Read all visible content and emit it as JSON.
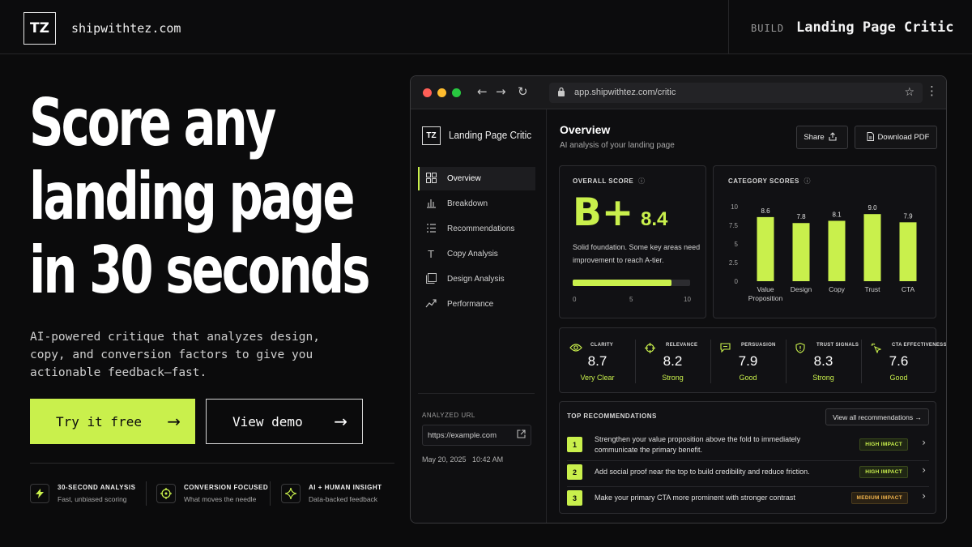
{
  "topbar": {
    "logo": "TZ",
    "brand": "shipwithtez.com",
    "section_label": "BUILD",
    "product_name": "Landing Page Critic"
  },
  "hero": {
    "title_lines": [
      "Score any",
      "landing page",
      "in 30 seconds"
    ],
    "description": "AI-powered critique that analyzes design, copy, and conversion factors to give you actionable feedback—fast.",
    "primary_cta": "Try it free",
    "secondary_cta": "View demo",
    "features": [
      {
        "icon": "bolt-icon",
        "title": "30-SECOND ANALYSIS",
        "subtitle": "Fast, unbiased scoring"
      },
      {
        "icon": "target-icon",
        "title": "CONVERSION FOCUSED",
        "subtitle": "What moves the needle"
      },
      {
        "icon": "sparkle-icon",
        "title": "AI + HUMAN INSIGHT",
        "subtitle": "Data-backed feedback"
      }
    ]
  },
  "browser": {
    "url": "app.shipwithtez.com/critic",
    "dot_colors": [
      "#ff5f57",
      "#febc2e",
      "#28c840"
    ]
  },
  "app": {
    "logo": "TZ",
    "name": "Landing Page Critic",
    "nav": [
      {
        "label": "Overview",
        "icon": "grid-icon",
        "active": true
      },
      {
        "label": "Breakdown",
        "icon": "bar-chart-icon",
        "active": false
      },
      {
        "label": "Recommendations",
        "icon": "list-icon",
        "active": false
      },
      {
        "label": "Copy Analysis",
        "icon": "text-icon",
        "active": false
      },
      {
        "label": "Design Analysis",
        "icon": "layout-icon",
        "active": false
      },
      {
        "label": "Performance",
        "icon": "trend-icon",
        "active": false
      }
    ],
    "analyzed_label": "ANALYZED URL",
    "analyzed_url": "https://example.com",
    "analyzed_time": "May 20, 2025   10:42 AM",
    "main_title": "Overview",
    "main_subtitle": "AI analysis of your landing page",
    "share_label": "Share",
    "download_label": "Download PDF",
    "overall": {
      "label": "OVERALL SCORE",
      "grade": "B+",
      "score": "8.4",
      "score_value": 8.4,
      "score_max": 10,
      "description": "Solid foundation. Some key areas need improvement to reach A-tier.",
      "ticks": [
        "0",
        "5",
        "10"
      ]
    },
    "metrics": [
      {
        "icon": "eye-icon",
        "label": "CLARITY",
        "value": "8.7",
        "rating": "Very Clear"
      },
      {
        "icon": "crosshair-icon",
        "label": "RELEVANCE",
        "value": "8.2",
        "rating": "Strong"
      },
      {
        "icon": "chat-icon",
        "label": "PERSUASION",
        "value": "7.9",
        "rating": "Good"
      },
      {
        "icon": "shield-icon",
        "label": "TRUST SIGNALS",
        "value": "8.3",
        "rating": "Strong"
      },
      {
        "icon": "cursor-click-icon",
        "label": "CTA EFFECTIVENESS",
        "value": "7.6",
        "rating": "Good"
      }
    ],
    "recommendations": {
      "title": "TOP RECOMMENDATIONS",
      "view_all": "View all recommendations →",
      "items": [
        {
          "num": "1",
          "text": "Strengthen your value proposition above the fold to immediately communicate the primary benefit.",
          "impact": "HIGH IMPACT",
          "level": "high"
        },
        {
          "num": "2",
          "text": "Add social proof near the top to build credibility and reduce friction.",
          "impact": "HIGH IMPACT",
          "level": "high"
        },
        {
          "num": "3",
          "text": "Make your primary CTA more prominent with stronger contrast",
          "impact": "MEDIUM IMPACT",
          "level": "medium"
        }
      ]
    }
  },
  "chart_data": {
    "type": "bar",
    "title": "CATEGORY SCORES",
    "categories": [
      "Value Proposition",
      "Design",
      "Copy",
      "Trust",
      "CTA"
    ],
    "category_lines": [
      [
        "Value",
        "Proposition"
      ],
      [
        "Design"
      ],
      [
        "Copy"
      ],
      [
        "Trust"
      ],
      [
        "CTA"
      ]
    ],
    "values": [
      8.6,
      7.8,
      8.1,
      9.0,
      7.9
    ],
    "value_labels": [
      "8.6",
      "7.8",
      "8.1",
      "9.0",
      "7.9"
    ],
    "y_ticks": [
      "0",
      "2.5",
      "5",
      "7.5",
      "10"
    ],
    "ylim": [
      0,
      10
    ],
    "grid": false,
    "bar_color": "#c9f04c"
  },
  "colors": {
    "accent": "#c9f04c",
    "background": "#0b0b0c",
    "medium_impact": "#f0b34c"
  }
}
